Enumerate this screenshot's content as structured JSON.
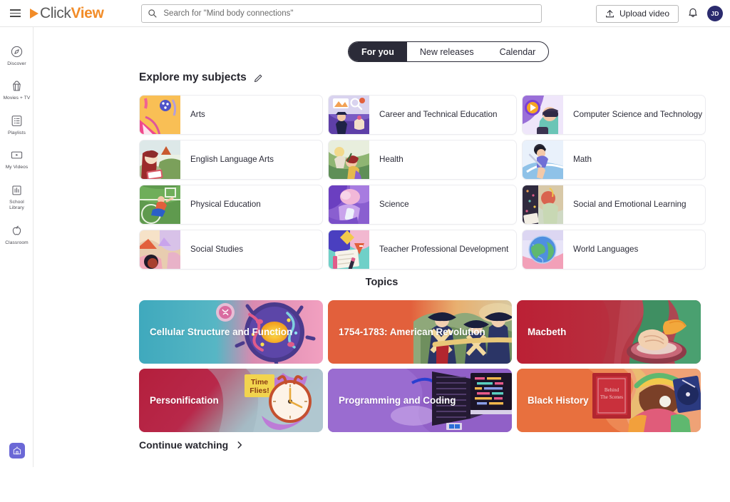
{
  "header": {
    "brand_click": "Click",
    "brand_view": "View",
    "menu_icon": "hamburger-icon",
    "search": {
      "placeholder": "Search for \"Mind body connections\"",
      "value": "",
      "icon": "search-icon"
    },
    "upload_label": "Upload video",
    "upload_icon": "upload-icon",
    "notifications_icon": "bell-icon",
    "avatar_initials": "JD"
  },
  "sidebar": {
    "items": [
      {
        "label": "Discover",
        "icon": "compass-icon"
      },
      {
        "label": "Movies + TV",
        "icon": "popcorn-icon"
      },
      {
        "label": "Playlists",
        "icon": "list-icon"
      },
      {
        "label": "My Videos",
        "icon": "video-icon"
      },
      {
        "label": "School Library",
        "icon": "library-icon"
      },
      {
        "label": "Classroom",
        "icon": "apple-icon"
      }
    ],
    "bottom_button_icon": "school-building-icon"
  },
  "tabs": [
    {
      "label": "For you",
      "active": true
    },
    {
      "label": "New releases",
      "active": false
    },
    {
      "label": "Calendar",
      "active": false
    }
  ],
  "subjects_section": {
    "title": "Explore my subjects",
    "edit_icon": "pencil-icon",
    "cards": [
      {
        "label": "Arts"
      },
      {
        "label": "Career and Technical Education"
      },
      {
        "label": "Computer Science and Technology"
      },
      {
        "label": "English Language Arts"
      },
      {
        "label": "Health"
      },
      {
        "label": "Math"
      },
      {
        "label": "Physical Education"
      },
      {
        "label": "Science"
      },
      {
        "label": "Social and Emotional Learning"
      },
      {
        "label": "Social Studies"
      },
      {
        "label": "Teacher Professional Development"
      },
      {
        "label": "World Languages"
      }
    ]
  },
  "topics_section": {
    "title": "Topics",
    "cards": [
      {
        "label": "Cellular Structure and Function",
        "color": "#3fa9bd"
      },
      {
        "label": "1754-1783: American Revolution",
        "color": "#e2603c"
      },
      {
        "label": "Macbeth",
        "color": "#bb2035"
      },
      {
        "label": "Personification",
        "color": "#b41f3c"
      },
      {
        "label": "Programming and Coding",
        "color": "#9164c8"
      },
      {
        "label": "Black History",
        "color": "#e8703e"
      }
    ]
  },
  "continue_watching": {
    "label": "Continue watching",
    "icon": "chevron-right-icon"
  },
  "colors": {
    "brand_orange": "#f28c28",
    "dark": "#2b2b38",
    "avatar": "#2b2b6e"
  }
}
